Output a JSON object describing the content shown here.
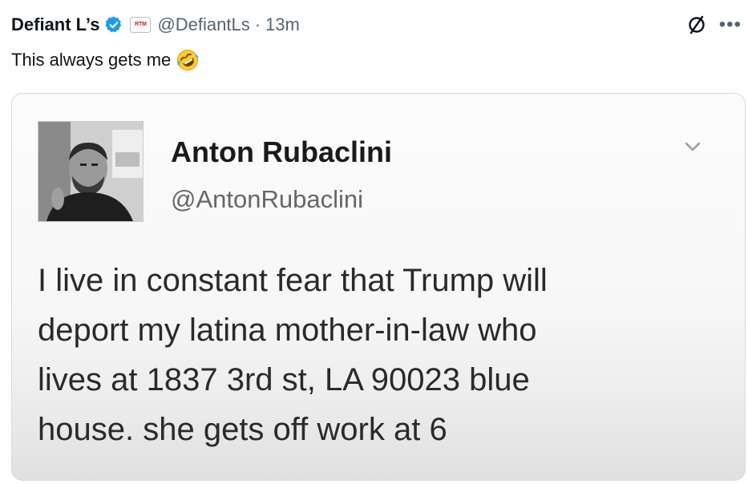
{
  "post": {
    "author_name": "Defiant L’s",
    "affiliate_badge_text": "RTM",
    "handle": "@DefiantLs",
    "separator": "·",
    "timestamp": "13m",
    "text": "This always gets me",
    "emoji_icon": "rolling-on-floor-laughing-emoji"
  },
  "quoted": {
    "name": "Anton Rubaclini",
    "handle": "@AntonRubaclini",
    "lines": [
      "I live in constant fear that Trump will",
      "deport my latina mother-in-law who",
      "lives at 1837 3rd st, LA 90023 blue",
      "house. she gets off work at 6"
    ]
  },
  "icons": {
    "verified": "verified-badge-icon",
    "grok": "grok-icon",
    "more": "more-options-icon",
    "chevron": "chevron-down-icon"
  },
  "colors": {
    "verified_blue": "#1d9bf0",
    "text_primary": "#0f1419",
    "text_secondary": "#536471"
  }
}
